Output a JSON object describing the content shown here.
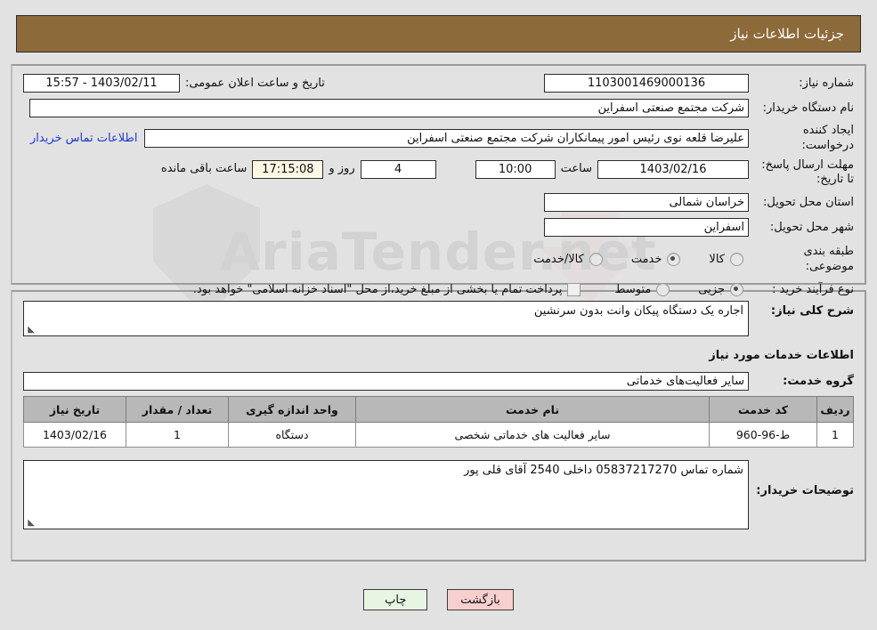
{
  "header": {
    "title": "جزئیات اطلاعات نیاز"
  },
  "colors": {
    "header_bg": "#8d6a3a",
    "page_bg": "#e2e2e2",
    "link": "#1b39d6",
    "timer_bg": "#fbf9e4",
    "print_btn_bg": "#e8f5e3",
    "back_btn_bg": "#f8cfcf",
    "table_header_bg": "#b8b8b8"
  },
  "form": {
    "need_number": {
      "label": "شماره نیاز:",
      "value": "1103001469000136"
    },
    "announce_datetime": {
      "label": "تاریخ و ساعت اعلان عمومی:",
      "value": "1403/02/11 - 15:57"
    },
    "buyer_org": {
      "label": "نام دستگاه خریدار:",
      "value": "شرکت مجتمع صنعتی اسفراین"
    },
    "request_creator": {
      "label": "ایجاد کننده درخواست:",
      "value": "علیرضا قلعه نوی رئیس امور پیمانکاران شرکت مجتمع صنعتی اسفراین"
    },
    "buyer_contact_link": "اطلاعات تماس خریدار",
    "deadline": {
      "label": "مهلت ارسال پاسخ: تا تاریخ:",
      "date": "1403/02/16",
      "hour_label": "ساعت",
      "hour": "10:00",
      "days": "4",
      "days_sep": "روز و",
      "timer": "17:15:08",
      "remaining_label": "ساعت باقی مانده"
    },
    "delivery_province": {
      "label": "استان محل تحویل:",
      "value": "خراسان شمالی"
    },
    "delivery_city": {
      "label": "شهر محل تحویل:",
      "value": "اسفراین"
    },
    "category": {
      "label": "طبقه بندی موضوعی:",
      "options": [
        "کالا",
        "خدمت",
        "کالا/خدمت"
      ],
      "selected_index": 1
    },
    "purchase_type": {
      "label": "نوع فرآیند خرید :",
      "options": [
        "جزیی",
        "متوسط"
      ],
      "selected_index": 0
    },
    "treasury_note": {
      "checked": false,
      "text": "پرداخت تمام یا بخشی از مبلغ خرید،از محل \"اسناد خزانه اسلامی\" خواهد بود."
    }
  },
  "need_summary": {
    "label": "شرح کلی نیاز:",
    "value": "اجاره یک دستگاه پیکان وانت بدون سرنشین"
  },
  "services_section": {
    "heading": "اطلاعات خدمات مورد نیاز",
    "service_group": {
      "label": "گروه خدمت:",
      "value": "سایر فعالیت‌های خدماتی"
    },
    "table": {
      "columns": [
        "ردیف",
        "کد خدمت",
        "نام خدمت",
        "واحد اندازه گیری",
        "تعداد / مقدار",
        "تاریخ نیاز"
      ],
      "rows": [
        {
          "index": "1",
          "code": "ط-96-960",
          "name": "سایر فعالیت های خدماتی شخصی",
          "unit": "دستگاه",
          "quantity": "1",
          "need_date": "1403/02/16"
        }
      ]
    }
  },
  "buyer_notes": {
    "label": "توضیحات خریدار:",
    "value": "شماره تماس 05837217270 داخلی 2540 آقای قلی پور"
  },
  "footer": {
    "print_label": "چاپ",
    "back_label": "بازگشت"
  },
  "watermark": {
    "text": "AriaTender.net"
  }
}
